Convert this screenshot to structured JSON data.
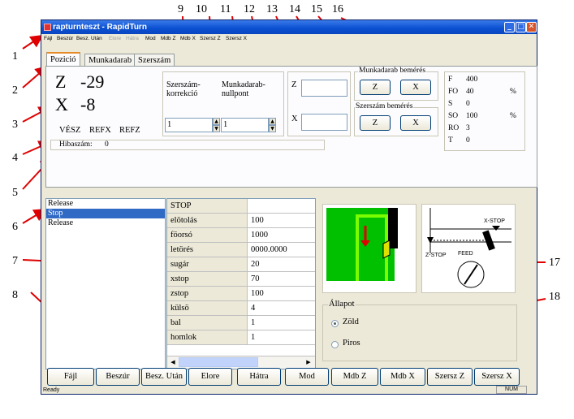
{
  "window": {
    "title": "rapturnteszt - RapidTurn",
    "menu": [
      "Fájl",
      "Beszúr",
      "Besz. Után",
      "Elore",
      "Hátra",
      "Mod",
      "Mdb Z",
      "Mdb X",
      "Szersz Z",
      "Szersz X"
    ],
    "minimize_glyph": "_",
    "maximize_glyph": "□",
    "close_glyph": "✕"
  },
  "tabs": [
    "Pozició",
    "Munkadarab",
    "Szerszám"
  ],
  "position": {
    "z_label": "Z",
    "z_value": "-29",
    "x_label": "X",
    "x_value": "-8",
    "flags": [
      "VÉSZ",
      "REFX",
      "REFZ"
    ],
    "error_label": "Hibaszám:",
    "error_value": "0"
  },
  "correction": {
    "tool_corr_label": "Szerszám-\nkorrekció",
    "work_zero_label": "Munkadarab-\nnullpont",
    "tool_corr_value": "1",
    "work_zero_value": "1"
  },
  "coords": {
    "z_label": "Z",
    "x_label": "X",
    "z_value": "",
    "x_value": ""
  },
  "workpiece_teach": {
    "label": "Munkadarab bemérés",
    "z_button": "Z",
    "x_button": "X"
  },
  "tool_teach": {
    "label": "Szerszám bemérés",
    "z_button": "Z",
    "x_button": "X"
  },
  "status": [
    {
      "key": "F",
      "value": "400",
      "unit": ""
    },
    {
      "key": "FO",
      "value": "40",
      "unit": "%"
    },
    {
      "key": "S",
      "value": "0",
      "unit": ""
    },
    {
      "key": "SO",
      "value": "100",
      "unit": "%"
    },
    {
      "key": "RO",
      "value": "3",
      "unit": ""
    },
    {
      "key": "T",
      "value": "0",
      "unit": ""
    }
  ],
  "list": [
    {
      "label": "Release",
      "selected": false
    },
    {
      "label": "Stop",
      "selected": true
    },
    {
      "label": "Release",
      "selected": false
    }
  ],
  "params": [
    {
      "key": "STOP",
      "value": ""
    },
    {
      "key": "elötolás",
      "value": "100"
    },
    {
      "key": "föorsó",
      "value": "1000"
    },
    {
      "key": "letörés",
      "value": "0000.0000"
    },
    {
      "key": "sugár",
      "value": "20"
    },
    {
      "key": "xstop",
      "value": "70"
    },
    {
      "key": "zstop",
      "value": "100"
    },
    {
      "key": "külsö",
      "value": "4"
    },
    {
      "key": "bal",
      "value": "1"
    },
    {
      "key": "homlok",
      "value": "1"
    }
  ],
  "diagram_labels": {
    "xstop": "X-STOP",
    "zstop": "Z-STOP",
    "feed": "FEED"
  },
  "state": {
    "label": "Állapot",
    "green": "Zöld",
    "red": "Piros",
    "selected": "green"
  },
  "buttons": [
    "Fájl",
    "Beszúr",
    "Besz. Után",
    "Elore",
    "Hátra",
    "Mod",
    "Mdb Z",
    "Mdb X",
    "Szersz Z",
    "Szersz X"
  ],
  "statusbar": {
    "left": "Ready",
    "right": "NUM"
  },
  "callout_numbers": [
    "1",
    "2",
    "3",
    "4",
    "5",
    "6",
    "7",
    "8",
    "9",
    "10",
    "11",
    "12",
    "13",
    "14",
    "15",
    "16",
    "17",
    "18"
  ],
  "colors": {
    "title_bar": "#0a4fd0",
    "selection": "#316ac5",
    "annotation": "#e00000",
    "diagram_green": "#00c000"
  }
}
